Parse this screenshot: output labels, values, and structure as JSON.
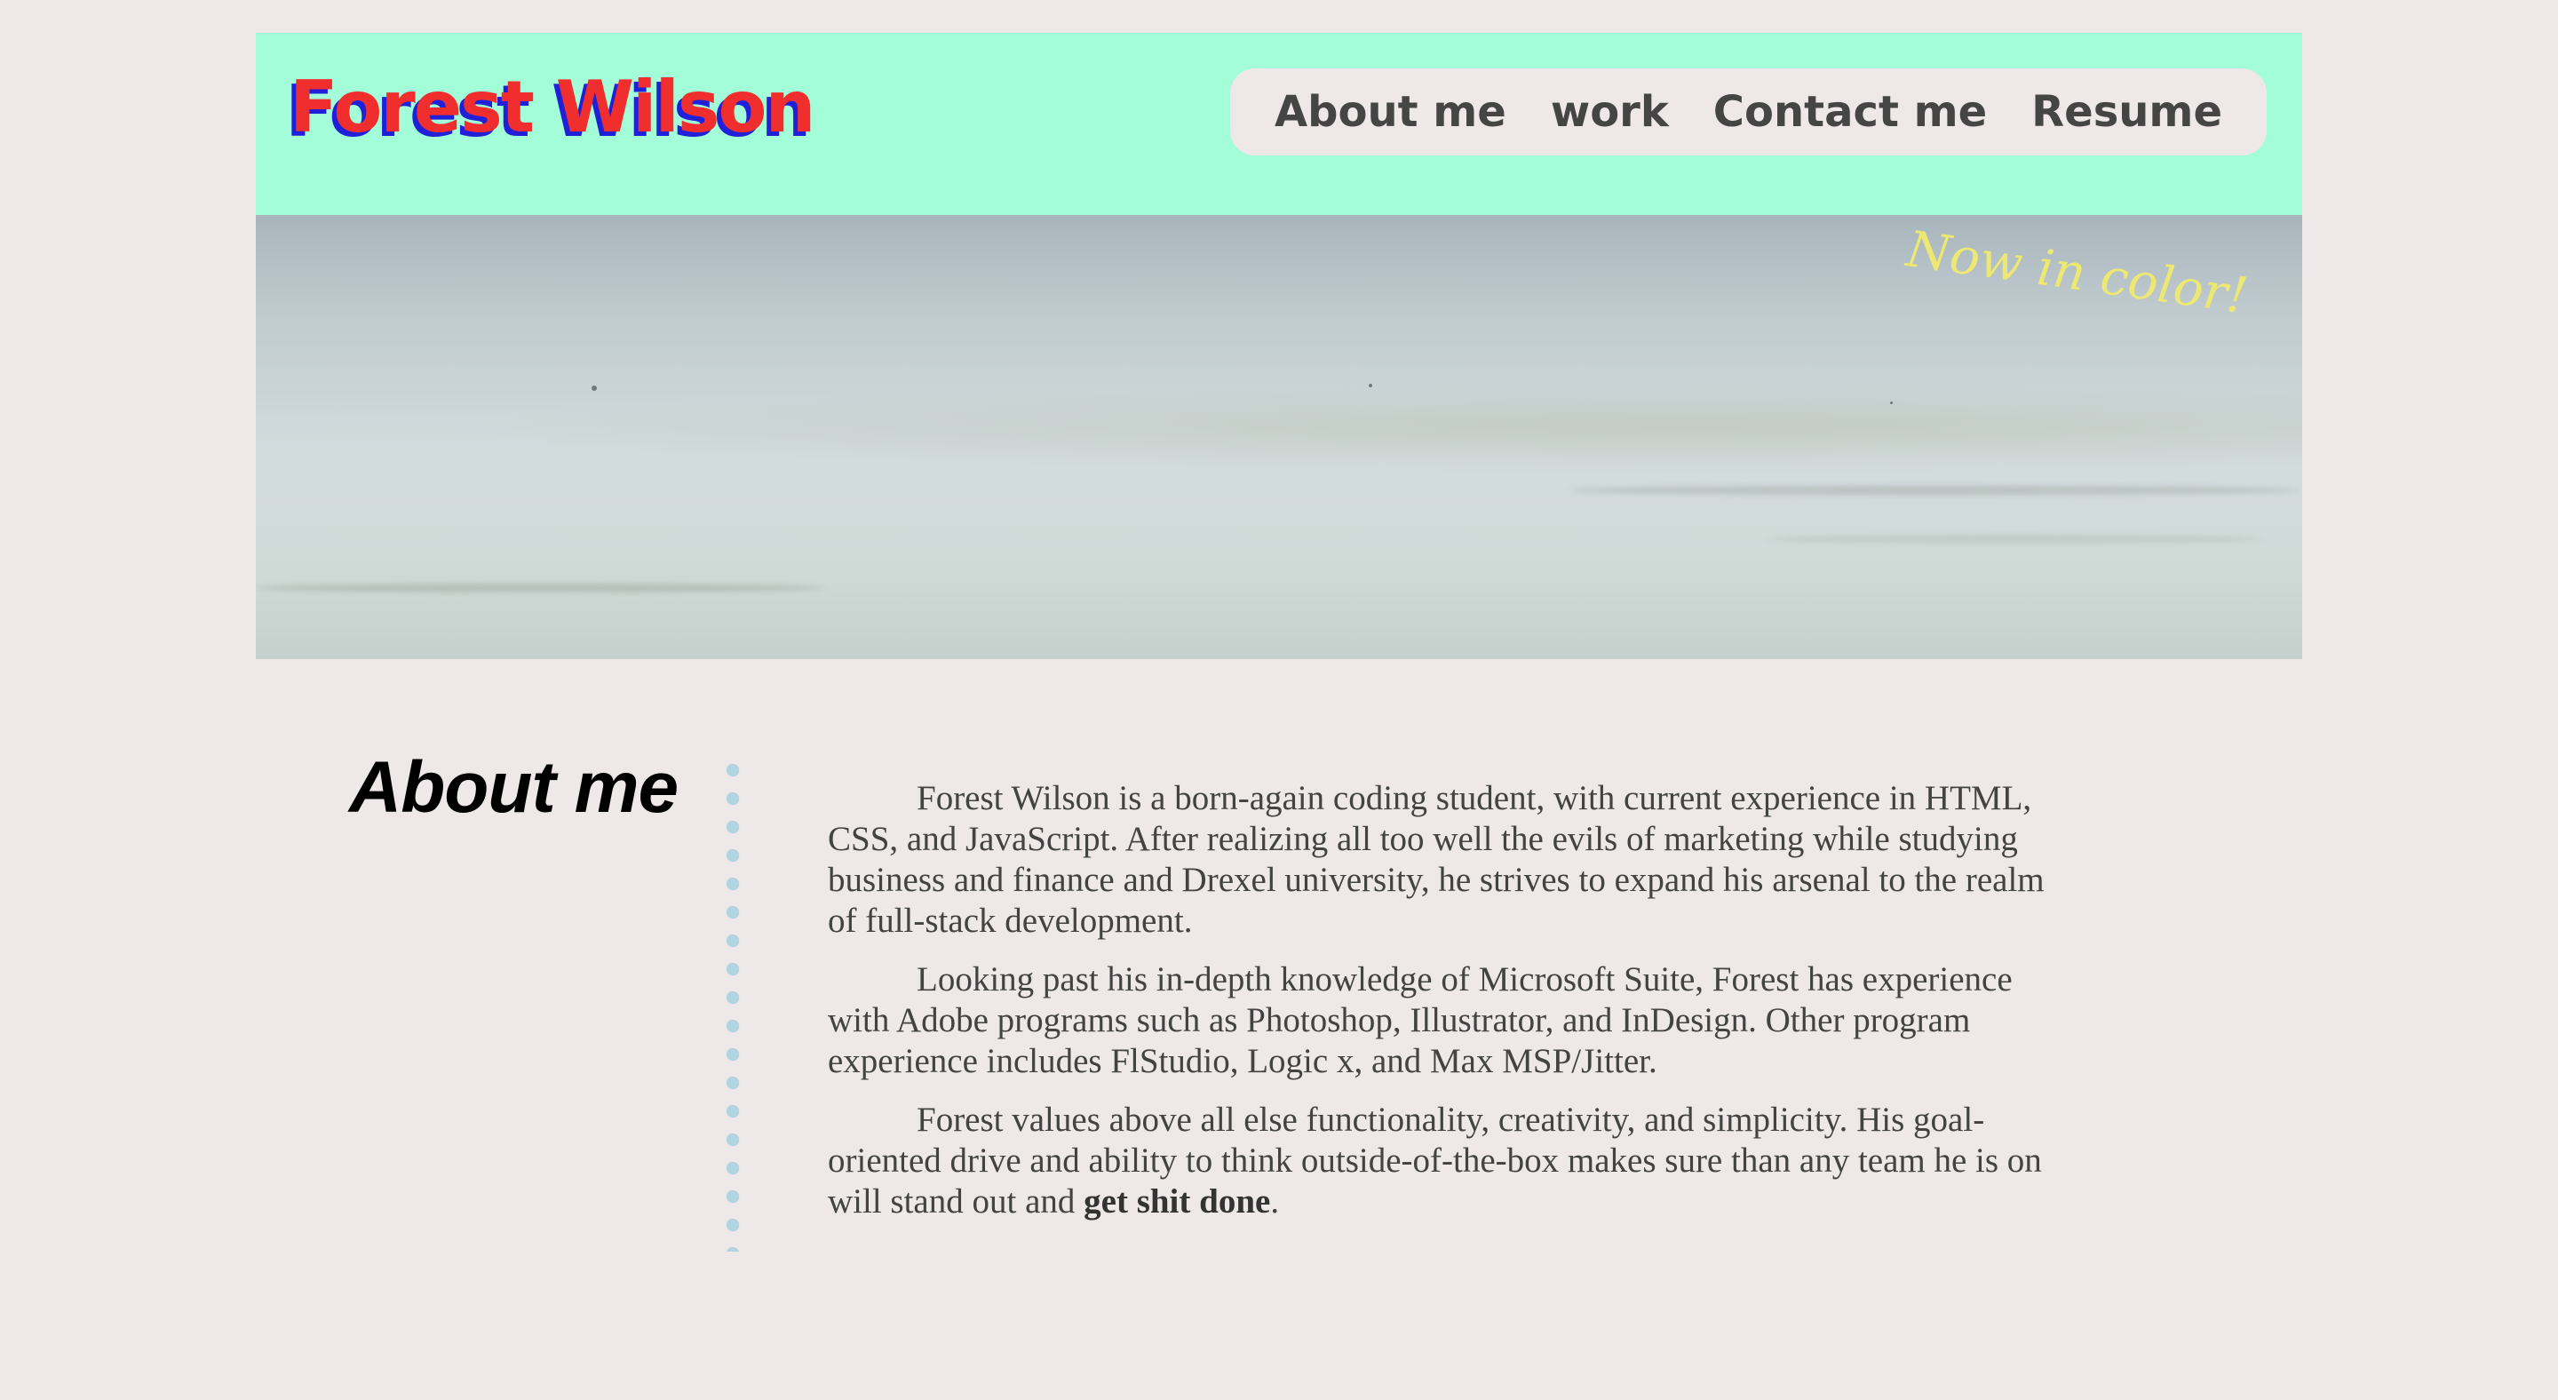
{
  "header": {
    "logo": "Forest Wilson",
    "nav": [
      {
        "label": "About me"
      },
      {
        "label": "work"
      },
      {
        "label": "Contact me"
      },
      {
        "label": "Resume"
      }
    ]
  },
  "hero": {
    "tagline": "Now in color!"
  },
  "about": {
    "heading": "About me",
    "paragraphs": [
      "Forest Wilson is a born-again coding student, with current experience in HTML, CSS, and JavaScript. After realizing all too well the evils of marketing while studying business and finance and Drexel university, he strives to expand his arsenal to the realm of full-stack development.",
      "Looking past his in-depth knowledge of Microsoft Suite, Forest has experience with Adobe programs such as Photoshop, Illustrator, and InDesign. Other program experience includes FlStudio, Logic x, and Max MSP/Jitter."
    ],
    "p3_before": "Forest values above all else functionality, creativity, and simplicity. His goal-oriented drive and ability to think outside-of-the-box makes sure than any team he is on will stand out and ",
    "p3_bold": "get shit done",
    "p3_after": "."
  },
  "colors": {
    "background": "#efe8e8",
    "header": "#a2fdd8",
    "logo": "#f12e2e",
    "logo_shadow": "#2020d8",
    "nav_text": "#454545",
    "tagline": "#ece872",
    "divider": "#b2d3e0"
  }
}
